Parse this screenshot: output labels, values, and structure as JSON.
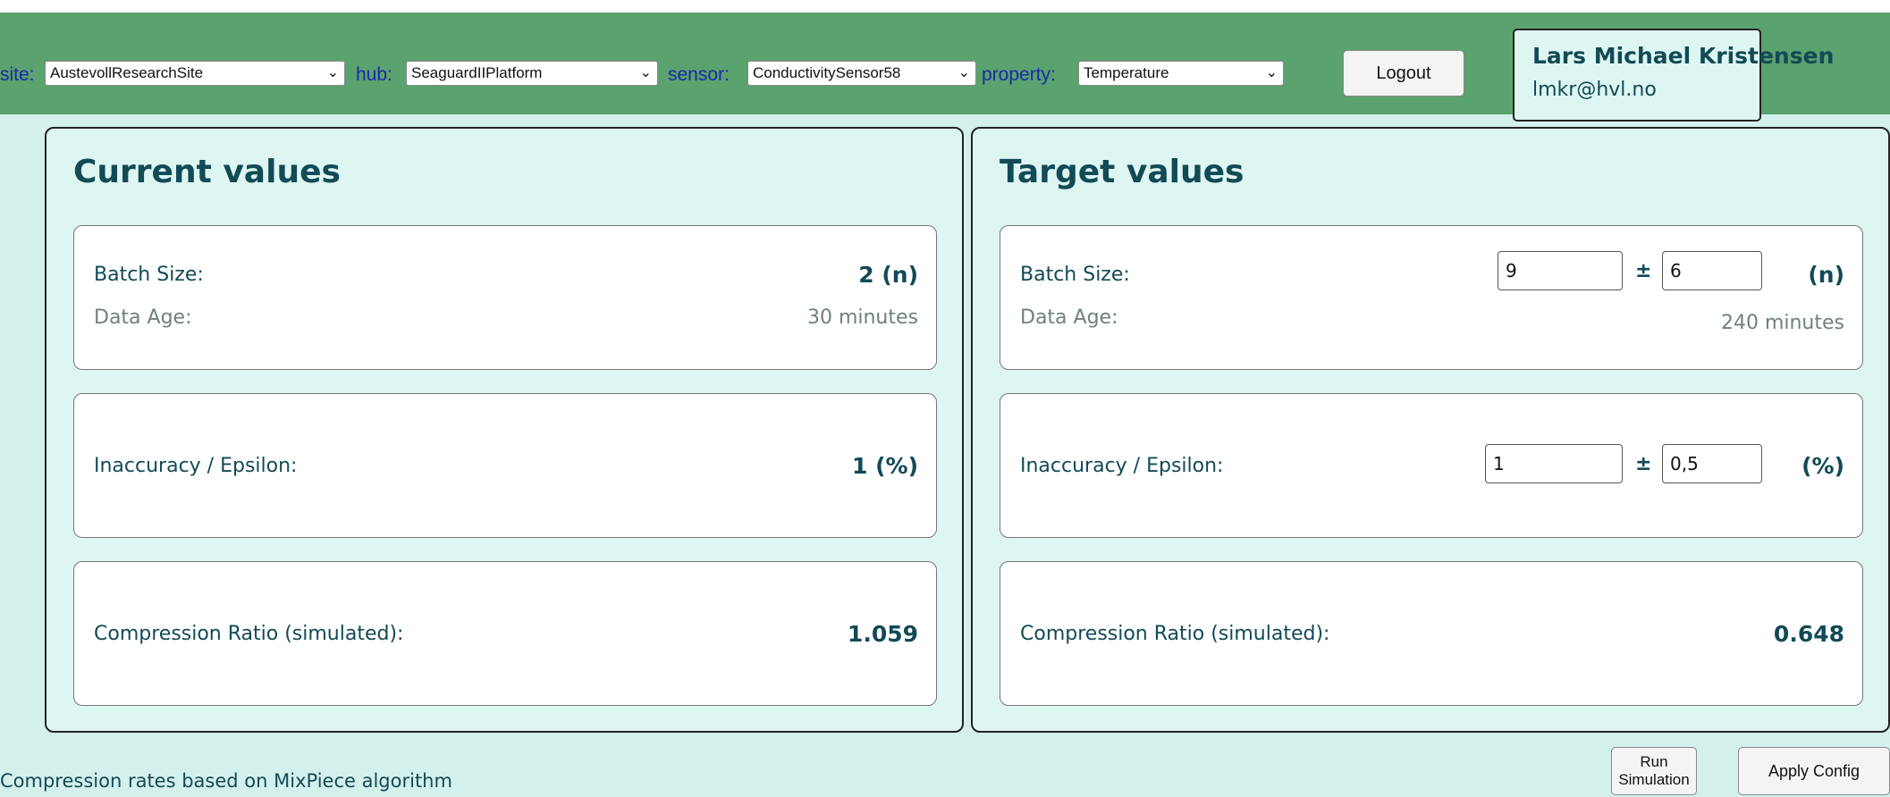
{
  "header": {
    "selectors": [
      {
        "label": "site:",
        "value": "AustevollResearchSite"
      },
      {
        "label": "hub:",
        "value": "SeaguardIIPlatform"
      },
      {
        "label": "sensor:",
        "value": "ConductivitySensor58"
      },
      {
        "label": "property:",
        "value": "Temperature"
      }
    ],
    "logout_label": "Logout",
    "user": {
      "name": "Lars Michael Kristensen",
      "email": "lmkr@hvl.no"
    }
  },
  "current": {
    "title": "Current values",
    "batch_size_label": "Batch Size:",
    "batch_size_value": "2 (n)",
    "data_age_label": "Data Age:",
    "data_age_value": "30 minutes",
    "inaccuracy_label": "Inaccuracy / Epsilon:",
    "inaccuracy_value": "1 (%)",
    "compression_label": "Compression Ratio (simulated):",
    "compression_value": "1.059"
  },
  "target": {
    "title": "Target values",
    "batch_size_label": "Batch Size:",
    "batch_size_input": "9",
    "batch_size_tolerance": "6",
    "batch_size_unit": "(n)",
    "data_age_label": "Data Age:",
    "data_age_value": "240 minutes",
    "inaccuracy_label": "Inaccuracy / Epsilon:",
    "inaccuracy_input": "1",
    "inaccuracy_tolerance": "0,5",
    "inaccuracy_unit": "(%)",
    "plus_minus": "±",
    "compression_label": "Compression Ratio (simulated):",
    "compression_value": "0.648"
  },
  "footer": {
    "note": "Compression rates based on MixPiece algorithm",
    "run_line1": "Run",
    "run_line2": "Simulation",
    "apply_label": "Apply Config"
  },
  "colors": {
    "topbar": "#5aa26e",
    "page_bg": "#d4f0ec",
    "panel_bg": "#ddf6f2",
    "heading": "#124a56",
    "select_label": "#1a2aa8"
  }
}
